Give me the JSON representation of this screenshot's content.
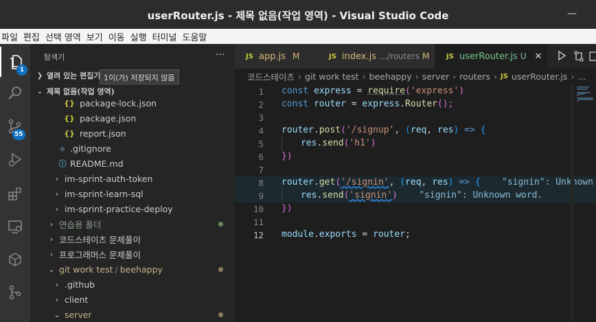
{
  "window": {
    "title": "userRouter.js - 제목 없음(작업 영역) - Visual Studio Code",
    "minimize_glyph": "—"
  },
  "menu": [
    "파일",
    "편집",
    "선택 영역",
    "보기",
    "이동",
    "실행",
    "터미널",
    "도움말"
  ],
  "activity": {
    "explorer_badge": "1",
    "scm_badge": "55"
  },
  "sidebar": {
    "title": "탐색기",
    "more": "···",
    "open_editors": "열려 있는 편집기",
    "open_editors_tooltip": "1이(가) 저장되지 않음",
    "workspace": "제목 없음(작업 영역)",
    "tree": [
      {
        "icon": "{}",
        "label": "package-lock.json"
      },
      {
        "icon": "{}",
        "label": "package.json"
      },
      {
        "icon": "{}",
        "label": "report.json"
      },
      {
        "icon": "◆",
        "label": ".gitignore"
      },
      {
        "icon": "ⓘ",
        "label": "README.md"
      },
      {
        "label": "im-sprint-auth-token"
      },
      {
        "label": "im-sprint-learn-sql"
      },
      {
        "label": "im-sprint-practice-deploy"
      },
      {
        "label": "연습용 폴더"
      },
      {
        "label": "코드스테이츠 문제풀이"
      },
      {
        "label": "프로그래머스 문제풀이"
      },
      {
        "label": "git work test",
        "label2": "beehappy",
        "sep": "/"
      },
      {
        "label": ".github"
      },
      {
        "label": "client"
      },
      {
        "label": "server"
      }
    ]
  },
  "tabs": [
    {
      "icon": "JS",
      "label": "app.js",
      "status": "M"
    },
    {
      "icon": "JS",
      "label": "index.js",
      "path": "…/routers",
      "status": "M"
    },
    {
      "icon": "JS",
      "label": "userRouter.js",
      "status": "U",
      "close": "✕"
    }
  ],
  "breadcrumb": [
    "코드스테이츠",
    "git work test",
    "beehappy",
    "server",
    "routers",
    "userRouter.js",
    "..."
  ],
  "editor": {
    "line_numbers": [
      "1",
      "2",
      "3",
      "4",
      "5",
      "6",
      "7",
      "8",
      "9",
      "10",
      "11",
      "12"
    ],
    "lines": {
      "l1": [
        "const",
        "express",
        "=",
        "require",
        "(",
        "'express'",
        ")"
      ],
      "l2": [
        "const",
        "router",
        "=",
        "express",
        ".",
        "Router",
        "();"
      ],
      "l4": [
        "router",
        ".",
        "post",
        "(",
        "'/signup'",
        ", ",
        "(",
        "req",
        ", ",
        "res",
        ")",
        " => ",
        "{"
      ],
      "l5": [
        "res",
        ".",
        "send",
        "(",
        "'h1'",
        ")"
      ],
      "l6": [
        "})"
      ],
      "l8": [
        "router",
        ".",
        "get",
        "(",
        "'/signin'",
        ", ",
        "(",
        "req",
        ", ",
        "res",
        ")",
        " => ",
        "{",
        "\"signin\": Unknown word."
      ],
      "l9": [
        "res",
        ".",
        "send",
        "(",
        "'signin'",
        ")",
        "\"signin\": Unknown word."
      ],
      "l10": [
        "})"
      ],
      "l12": [
        "module",
        ".",
        "exports",
        " = ",
        "router",
        ";"
      ]
    }
  }
}
